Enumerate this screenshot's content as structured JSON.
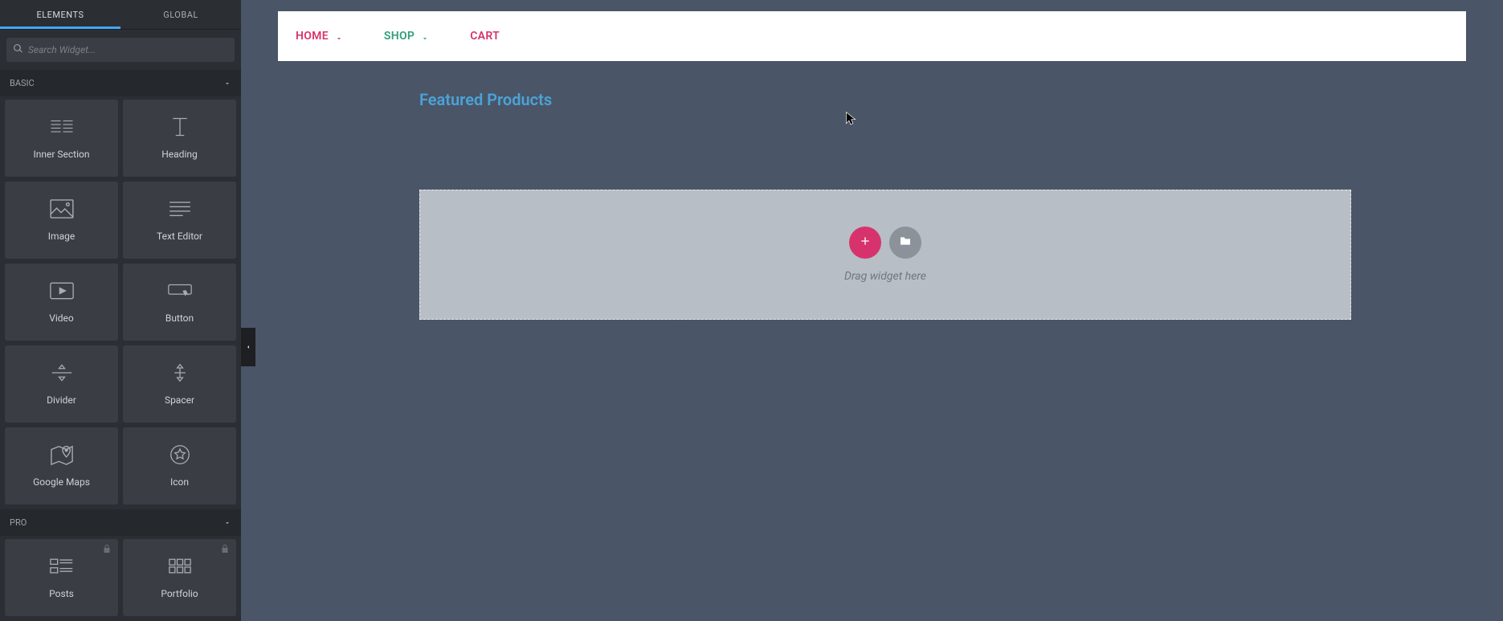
{
  "sidebar": {
    "tabs": {
      "elements": "ELEMENTS",
      "global": "GLOBAL"
    },
    "search_placeholder": "Search Widget...",
    "sections": {
      "basic": {
        "title": "BASIC",
        "widgets": [
          {
            "name": "inner-section",
            "label": "Inner Section"
          },
          {
            "name": "heading",
            "label": "Heading"
          },
          {
            "name": "image",
            "label": "Image"
          },
          {
            "name": "text-editor",
            "label": "Text Editor"
          },
          {
            "name": "video",
            "label": "Video"
          },
          {
            "name": "button",
            "label": "Button"
          },
          {
            "name": "divider",
            "label": "Divider"
          },
          {
            "name": "spacer",
            "label": "Spacer"
          },
          {
            "name": "google-maps",
            "label": "Google Maps"
          },
          {
            "name": "icon",
            "label": "Icon"
          }
        ]
      },
      "pro": {
        "title": "PRO",
        "widgets": [
          {
            "name": "posts",
            "label": "Posts",
            "locked": true
          },
          {
            "name": "portfolio",
            "label": "Portfolio",
            "locked": true
          }
        ]
      }
    }
  },
  "preview": {
    "nav": [
      {
        "label": "HOME",
        "color": "pink",
        "dropdown": true
      },
      {
        "label": "SHOP",
        "color": "green",
        "dropdown": true
      },
      {
        "label": "CART",
        "color": "pink",
        "dropdown": false
      }
    ],
    "heading": "Featured Products",
    "dropzone_hint": "Drag widget here"
  }
}
